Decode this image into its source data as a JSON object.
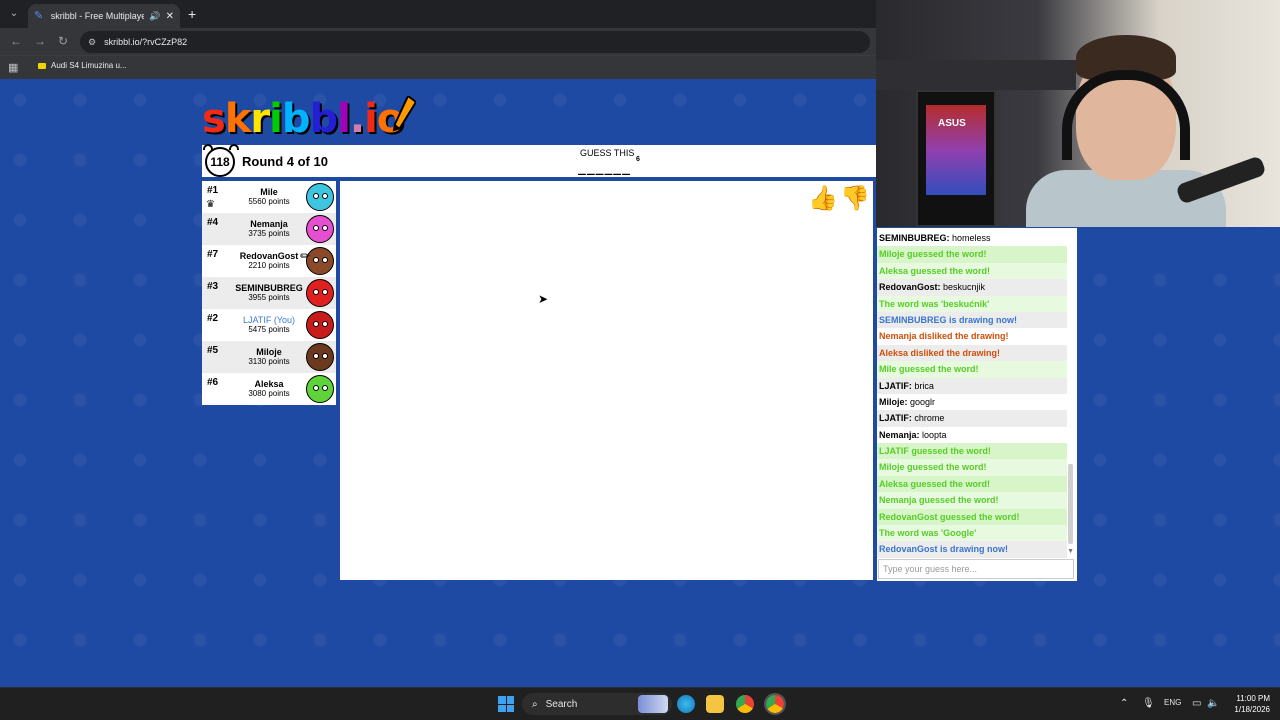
{
  "browser": {
    "tab_title": "skribbl - Free Multiplayer Dr",
    "url": "skribbl.io/?rvCZzP82",
    "bookmark": "Audi S4 Limuzina u..."
  },
  "game": {
    "logo": [
      "s",
      "k",
      "r",
      "i",
      "b",
      "b",
      "l",
      ".",
      "i",
      "o"
    ],
    "logo_colors": [
      "#ef2b17",
      "#ff7100",
      "#ffe400",
      "#00cc00",
      "#00b2ff",
      "#231fd3",
      "#a300ba",
      "#d37caa",
      "#ef2b17",
      "#ff7100"
    ],
    "timer": "118",
    "round": "Round 4 of 10",
    "guess_label": "GUESS THIS",
    "guess_count": "6",
    "guess_blanks": "______"
  },
  "players": [
    {
      "rank": "#1",
      "name": "Mile",
      "points": "5560 points",
      "color": "#3ec6e0"
    },
    {
      "rank": "#4",
      "name": "Nemanja",
      "points": "3735 points",
      "color": "#e64fd0"
    },
    {
      "rank": "#7",
      "name": "RedovanGost",
      "points": "2210 points",
      "color": "#8a4a2a"
    },
    {
      "rank": "#3",
      "name": "SEMINBUBREG",
      "points": "3955 points",
      "color": "#e02020"
    },
    {
      "rank": "#2",
      "name": "LJATIF (You)",
      "points": "5475 points",
      "color": "#c81c1c"
    },
    {
      "rank": "#5",
      "name": "Miloje",
      "points": "3130 points",
      "color": "#6b3a1e"
    },
    {
      "rank": "#6",
      "name": "Aleksa",
      "points": "3080 points",
      "color": "#5ed43a"
    }
  ],
  "chat": {
    "messages": [
      {
        "user": "SEMINBUBREG:",
        "text": " homeless"
      },
      {
        "text": "Miloje guessed the word!"
      },
      {
        "text": "Aleksa guessed the word!"
      },
      {
        "user": "RedovanGost:",
        "text": " beskucnjik"
      },
      {
        "text": "The word was 'beskućnik'"
      },
      {
        "text": "SEMINBUBREG is drawing now!"
      },
      {
        "text": "Nemanja disliked the drawing!"
      },
      {
        "text": "Aleksa disliked the drawing!"
      },
      {
        "text": "Mile guessed the word!"
      },
      {
        "user": "LJATIF:",
        "text": " brica"
      },
      {
        "user": "Miloje:",
        "text": " googlr"
      },
      {
        "user": "LJATIF:",
        "text": " chrome"
      },
      {
        "user": "Nemanja:",
        "text": " loopta"
      },
      {
        "text": "LJATIF guessed the word!"
      },
      {
        "text": "Miloje guessed the word!"
      },
      {
        "text": "Aleksa guessed the word!"
      },
      {
        "text": "Nemanja guessed the word!"
      },
      {
        "text": "RedovanGost guessed the word!"
      },
      {
        "text": "The word was 'Google'"
      },
      {
        "text": "RedovanGost is drawing now!"
      }
    ],
    "input_placeholder": "Type your guess here..."
  },
  "webcam": {
    "case_text": "ASUS"
  },
  "taskbar": {
    "search": "Search",
    "lang": "ENG",
    "time": "11:00 PM",
    "date": "1/18/2026"
  }
}
